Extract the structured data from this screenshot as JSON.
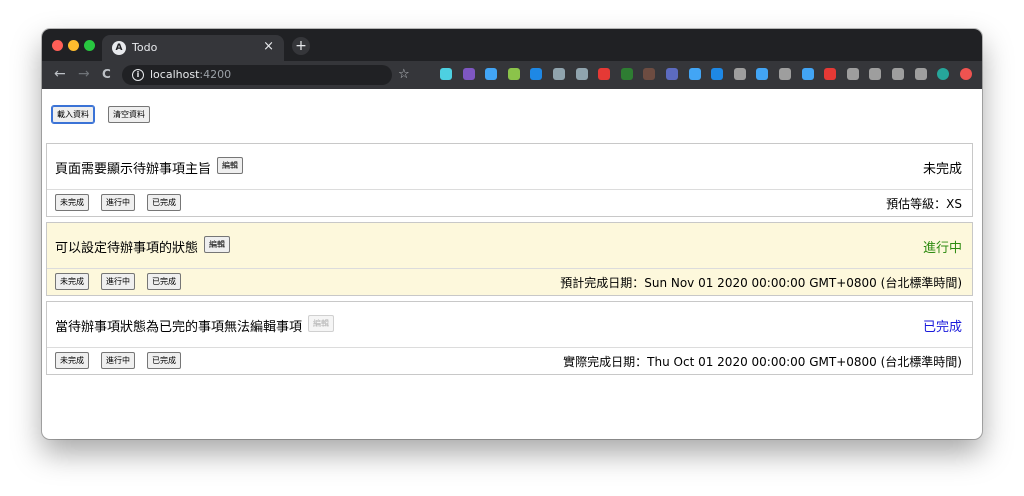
{
  "browser": {
    "tab_title": "Todo",
    "tab_favicon": "A",
    "tab_close": "×",
    "new_tab": "+",
    "url_host": "localhost",
    "url_port": ":4200",
    "back": "←",
    "forward": "→",
    "reload": "C",
    "star": "☆",
    "extension_colors": [
      "#4dd0e1",
      "#7e57c2",
      "#42a5f5",
      "#8bc34a",
      "#1e88e5",
      "#90a4ae",
      "#90a4ae",
      "#e53935",
      "#2e7d32",
      "#6d4c41",
      "#5c6bc0",
      "#42a5f5",
      "#1e88e5",
      "#9e9e9e",
      "#42a5f5",
      "#9e9e9e",
      "#42a5f5",
      "#e53935",
      "#9e9e9e",
      "#9e9e9e",
      "#9e9e9e",
      "#9e9e9e",
      "#26a69a",
      "#ef5350"
    ]
  },
  "actions": {
    "load_label": "載入資料",
    "clear_label": "清空資料"
  },
  "status_buttons": {
    "todo": "未完成",
    "doing": "進行中",
    "done": "已完成"
  },
  "edit_label": "編輯",
  "todos": [
    {
      "title": "頁面需要顯示待辦事項主旨",
      "status": "未完成",
      "status_color": "#000000",
      "background": "#ffffff",
      "info": "預估等級：XS",
      "edit_disabled": false
    },
    {
      "title": "可以設定待辦事項的狀態",
      "status": "進行中",
      "status_color": "#2e8b12",
      "background": "#fdf8dc",
      "info": "預計完成日期：Sun Nov 01 2020 00:00:00 GMT+0800 (台北標準時間)",
      "edit_disabled": false
    },
    {
      "title": "當待辦事項狀態為已完的事項無法編輯事項",
      "status": "已完成",
      "status_color": "#1a1adb",
      "background": "#ffffff",
      "info": "實際完成日期：Thu Oct 01 2020 00:00:00 GMT+0800 (台北標準時間)",
      "edit_disabled": true
    }
  ]
}
